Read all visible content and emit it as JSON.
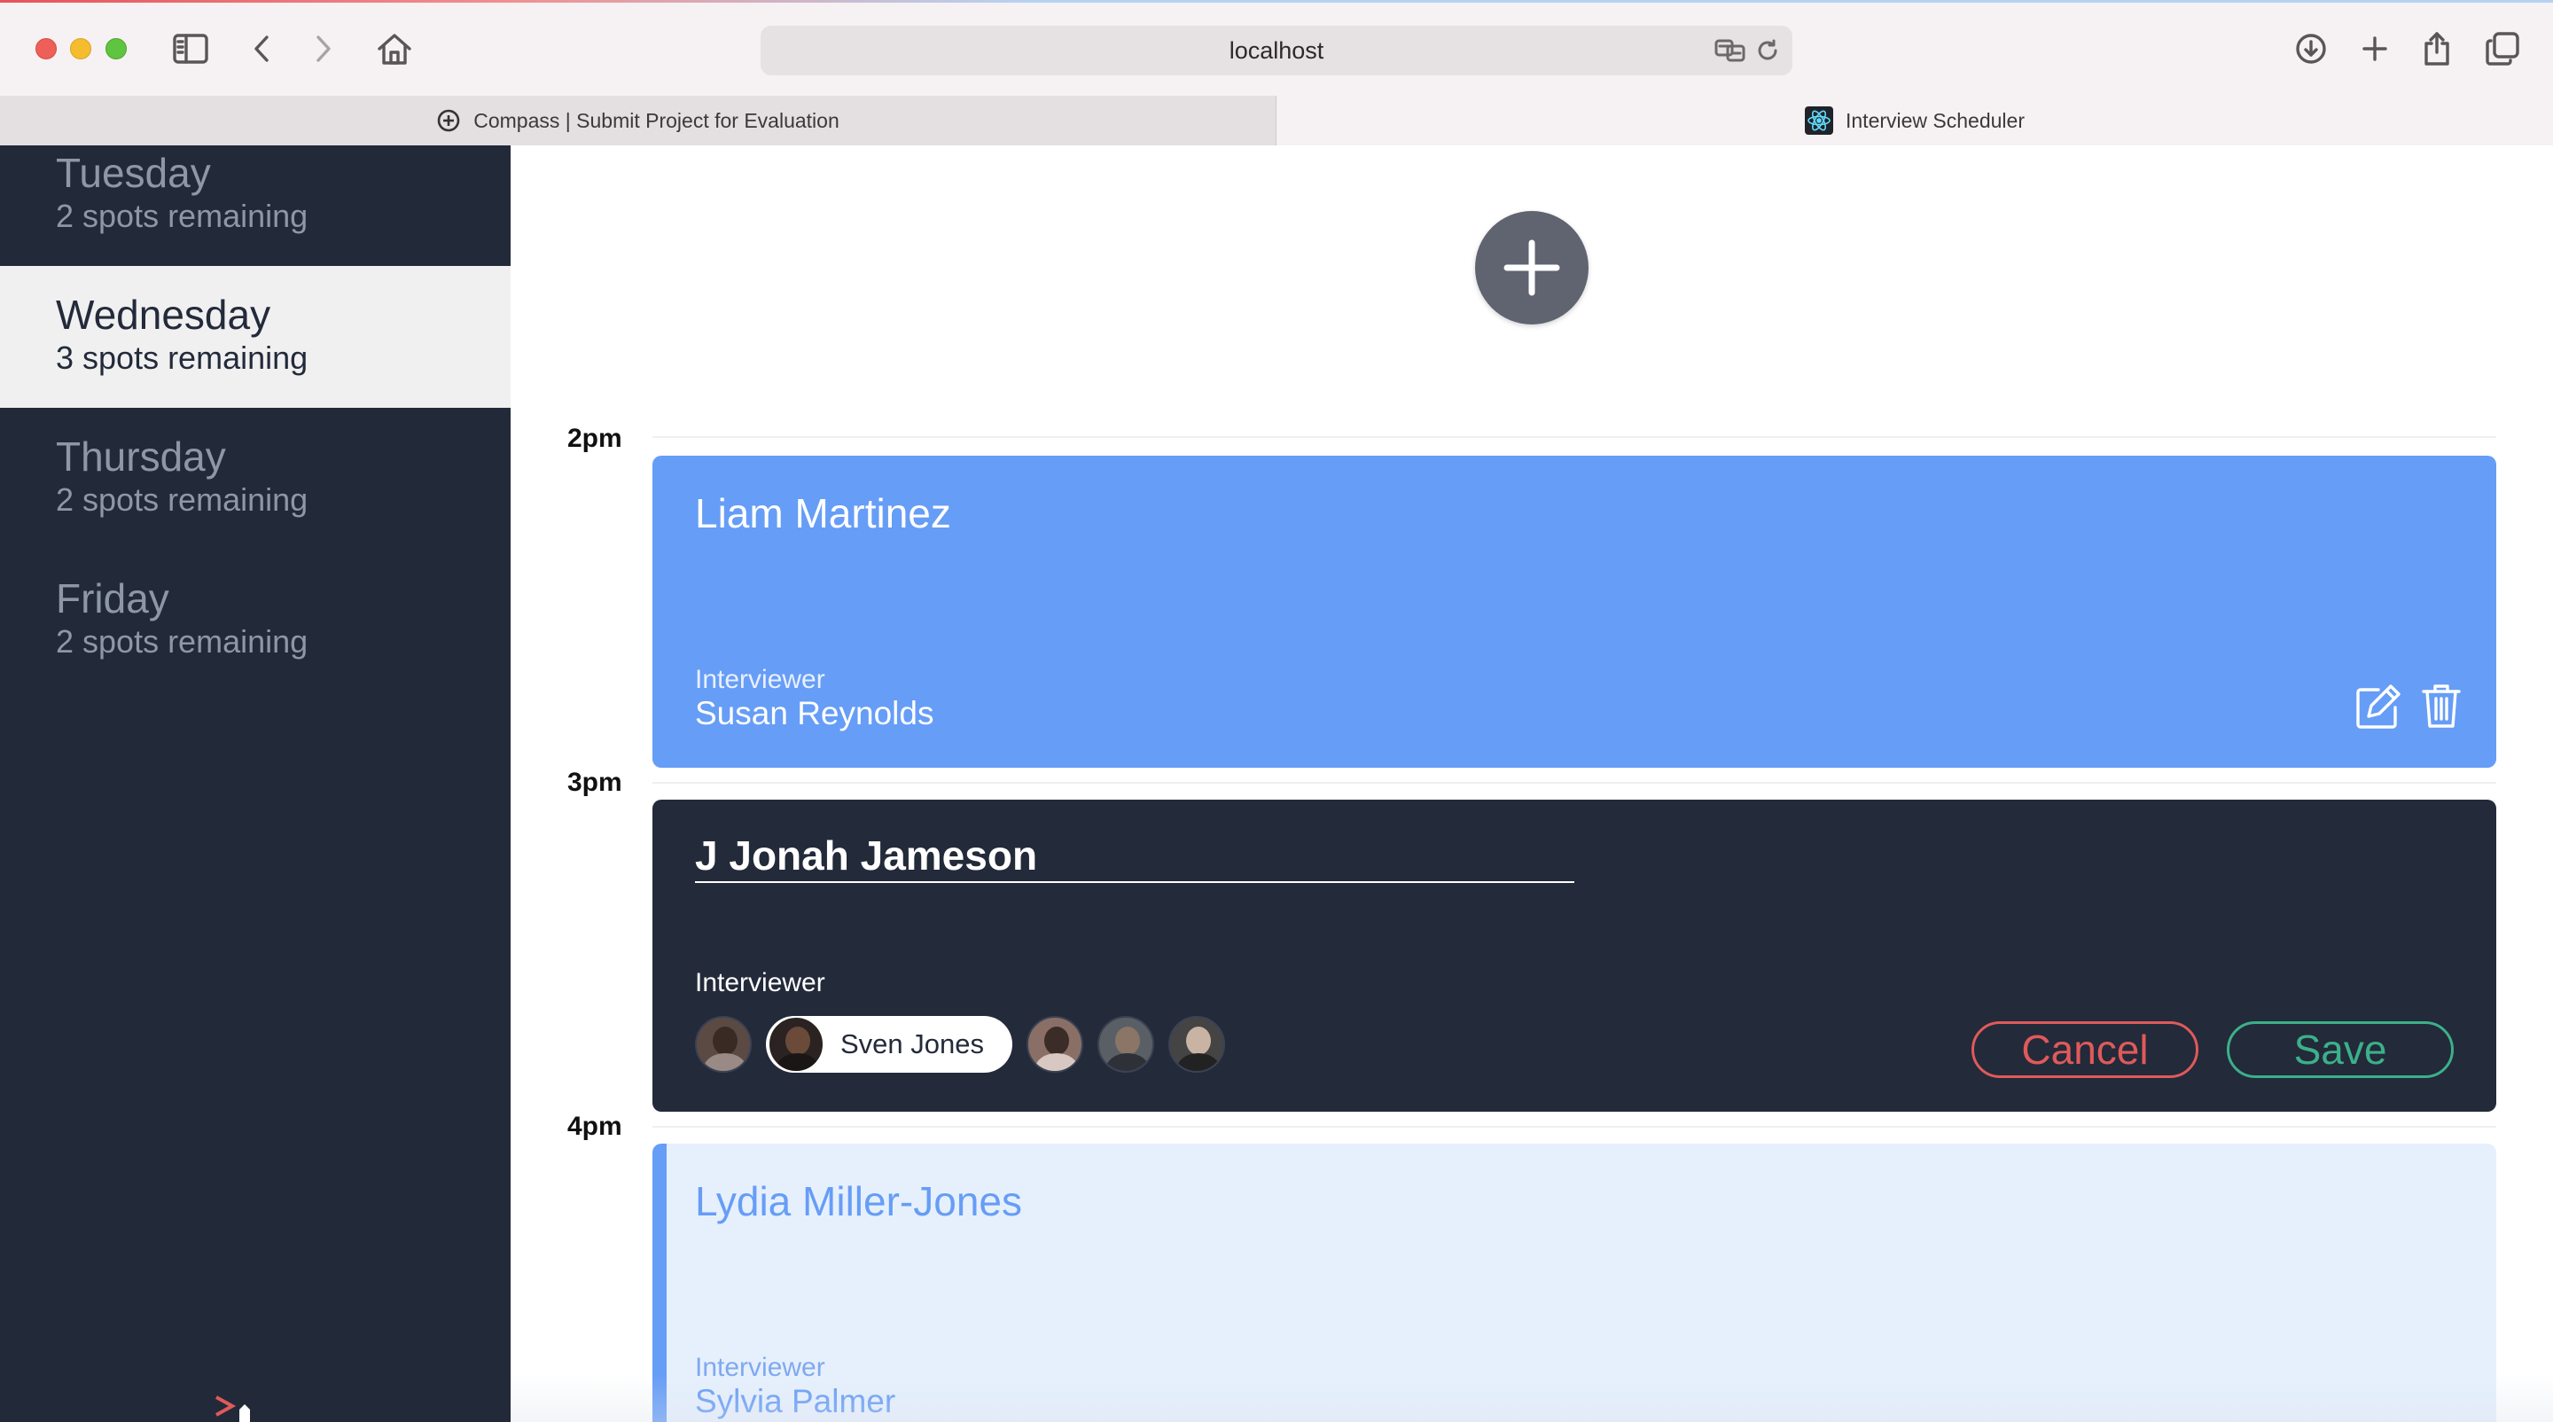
{
  "browser": {
    "url": "localhost",
    "tabs": [
      {
        "label": "Compass | Submit Project for Evaluation"
      },
      {
        "label": "Interview Scheduler"
      }
    ]
  },
  "sidebar": {
    "days": [
      {
        "name": "Tuesday",
        "spots": "2 spots remaining",
        "selected": false
      },
      {
        "name": "Wednesday",
        "spots": "3 spots remaining",
        "selected": true
      },
      {
        "name": "Thursday",
        "spots": "2 spots remaining",
        "selected": false
      },
      {
        "name": "Friday",
        "spots": "2 spots remaining",
        "selected": false
      }
    ]
  },
  "schedule": {
    "times": [
      "2pm",
      "3pm",
      "4pm"
    ],
    "booked": {
      "student": "Liam Martinez",
      "interviewer_label": "Interviewer",
      "interviewer": "Susan Reynolds"
    },
    "form": {
      "student_value": "J Jonah Jameson",
      "interviewer_label": "Interviewer",
      "selected_interviewer": "Sven Jones",
      "cancel_label": "Cancel",
      "save_label": "Save"
    },
    "next": {
      "student": "Lydia Miller-Jones",
      "interviewer_label": "Interviewer",
      "interviewer": "Sylvia Palmer"
    }
  },
  "colors": {
    "sidebar_bg": "#222a3a",
    "booked_bg": "#669df6",
    "form_bg": "#232a3a",
    "cancel": "#e05a5a",
    "save": "#3bb08a"
  }
}
